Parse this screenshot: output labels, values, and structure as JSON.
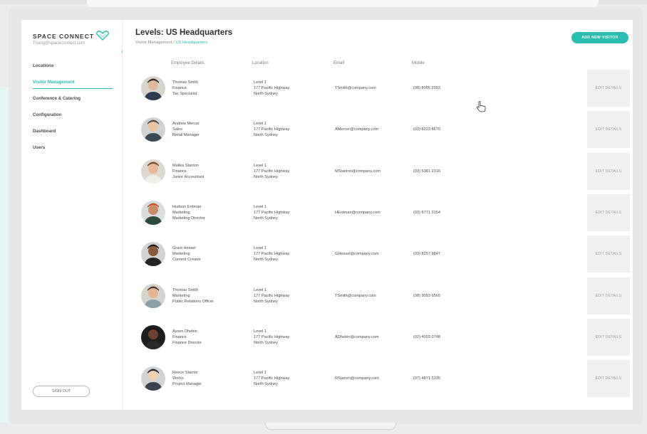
{
  "sidebar": {
    "brand_name": "SPACE CONNECT",
    "brand_sub": "Tnang@spaceconnect.com",
    "items": [
      {
        "label": "Locations",
        "active": false
      },
      {
        "label": "Visitor Management",
        "active": true
      },
      {
        "label": "Conference & Catering",
        "active": false
      },
      {
        "label": "Configuration",
        "active": false
      },
      {
        "label": "Dashboard",
        "active": false
      },
      {
        "label": "Users",
        "active": false
      }
    ],
    "sign_out": "SIGN OUT"
  },
  "header": {
    "title": "Levels: US Headquarters",
    "breadcrumb_root": "Visitor Management",
    "breadcrumb_sep": "/",
    "breadcrumb_current": "US Headquarters",
    "add_button": "ADD NEW VISITOR"
  },
  "columns": [
    "Employee Details",
    "Location",
    "Email",
    "Mobile"
  ],
  "edit_label": "EDIT DETAILS",
  "colors": {
    "accent": "#2bbdb0",
    "text": "#2b2b2b",
    "muted": "#8a8a8a"
  },
  "rows": [
    {
      "name": "Thomas Smith",
      "dept": "Finance",
      "role": "Tax Specialist",
      "loc1": "Level 1",
      "loc2": "177 Pacific Highway",
      "loc3": "North Sydney",
      "email": "TSmith@company.com",
      "mobile": "(08) 8005 2093"
    },
    {
      "name": "Andrew Mercer",
      "dept": "Sales",
      "role": "Retail Manager",
      "loc1": "Level 1",
      "loc2": "177 Pacific Highway",
      "loc3": "North Sydney",
      "email": "AMercer@company.com",
      "mobile": "(03) 8223 8670"
    },
    {
      "name": "Malika Stanton",
      "dept": "Finance",
      "role": "Junior Accountant",
      "loc1": "Level 1",
      "loc2": "177 Pacific Highway",
      "loc3": "North Sydney",
      "email": "MStanton@company.com",
      "mobile": "(03) 5381 2316"
    },
    {
      "name": "Hudson Erdman",
      "dept": "Marketing",
      "role": "Marketing Director",
      "loc1": "Level 1",
      "loc2": "177 Pacific Highway",
      "loc3": "North Sydney",
      "email": "HErdman@company.com",
      "mobile": "(03) 6771 2154"
    },
    {
      "name": "Grant Hessel",
      "dept": "Marketing",
      "role": "Content Creator",
      "loc1": "Level 1",
      "loc2": "177 Pacific Highway",
      "loc3": "North Sydney",
      "email": "GHessel@company.com",
      "mobile": "(03) 8257 9847"
    },
    {
      "name": "Thomas Smith",
      "dept": "Marketing",
      "role": "Public Relations Officer",
      "loc1": "Level 1",
      "loc2": "177 Pacific Highway",
      "loc3": "North Sydney",
      "email": "TSmith@company.com",
      "mobile": "(08) 9093 6565"
    },
    {
      "name": "Aysen Dhebin",
      "dept": "Finance",
      "role": "Finance Director",
      "loc1": "Level 1",
      "loc2": "177 Pacific Highway",
      "loc3": "North Sydney",
      "email": "ADhebin@company.com",
      "mobile": "(02) 4003 0748"
    },
    {
      "name": "Reece Stamm",
      "dept": "Works",
      "role": "Project Manager",
      "loc1": "Level 1",
      "loc2": "177 Pacific Highway",
      "loc3": "North Sydney",
      "email": "RStamm@company.com",
      "mobile": "(07) 4871 5335"
    }
  ]
}
